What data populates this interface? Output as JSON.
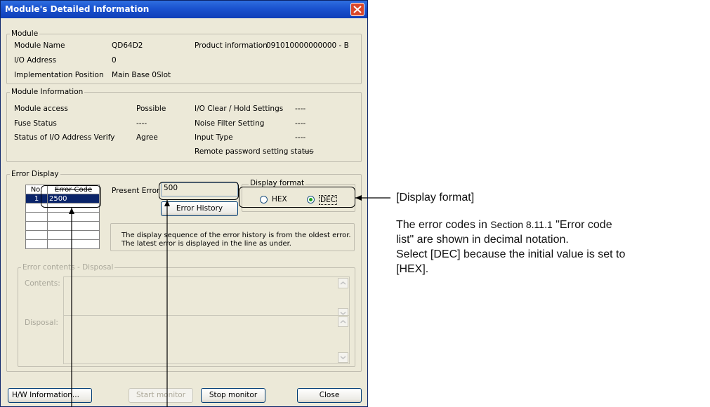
{
  "window": {
    "title": "Module's Detailed Information"
  },
  "module": {
    "group_label": "Module",
    "name_label": "Module Name",
    "name_value": "QD64D2",
    "io_label": "I/O Address",
    "io_value": "0",
    "impl_label": "Implementation Position",
    "impl_value": "Main Base  0Slot",
    "product_label": "Product information",
    "product_value": "091010000000000 - B"
  },
  "module_info": {
    "group_label": "Module Information",
    "access_label": "Module access",
    "access_value": "Possible",
    "fuse_label": "Fuse Status",
    "fuse_value": "----",
    "verify_label": "Status of I/O Address Verify",
    "verify_value": "Agree",
    "clear_label": "I/O Clear / Hold Settings",
    "clear_value": "----",
    "noise_label": "Noise Filter Setting",
    "noise_value": "----",
    "input_label": "Input Type",
    "input_value": "----",
    "remote_label": "Remote password setting status",
    "remote_value": "----"
  },
  "error_display": {
    "group_label": "Error Display",
    "col_no": "No.",
    "col_code": "Error Code",
    "rows": [
      {
        "no": "1",
        "code": "2500"
      }
    ],
    "present_label": "Present Error",
    "present_value": "500",
    "history_button": "Error History",
    "format_label": "Display format",
    "hex_label": "HEX",
    "dec_label": "DEC",
    "selected_format": "DEC",
    "info_line1": "The display sequence of the error history is from the oldest error.",
    "info_line2": "The latest error is displayed in the line as under."
  },
  "error_contents": {
    "group_label": "Error contents - Disposal",
    "contents_label": "Contents:",
    "disposal_label": "Disposal:"
  },
  "buttons": {
    "hw_info": "H/W Information...",
    "start_monitor": "Start monitor",
    "stop_monitor": "Stop monitor",
    "close": "Close"
  },
  "annotation": {
    "heading": "[Display format]",
    "line1_pre": "The error codes in ",
    "line1_section": "Section 8.11.1",
    "line1_post": " \"Error code",
    "line2": "list\" are shown in decimal notation.",
    "line3": "Select [DEC] because the initial value is set to",
    "line4": "[HEX]."
  }
}
